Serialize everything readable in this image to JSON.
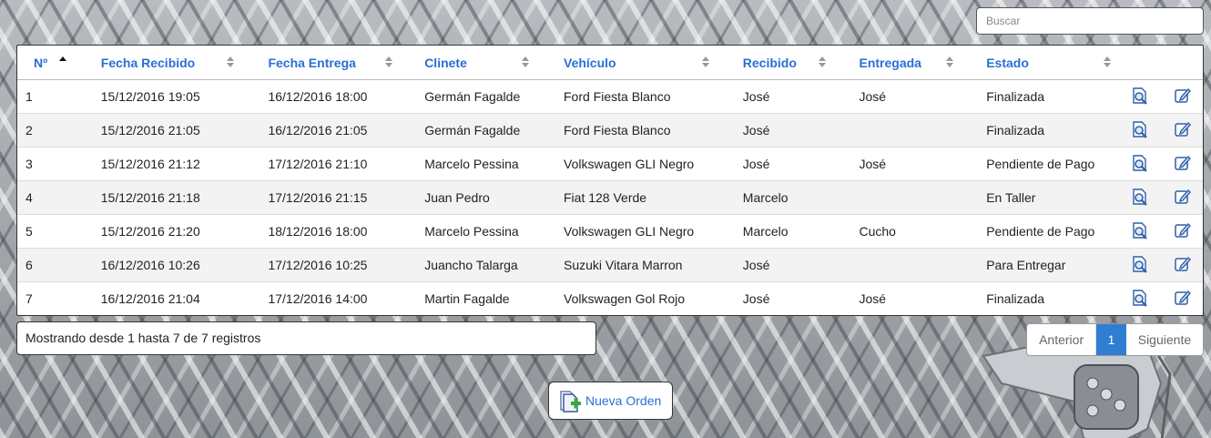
{
  "search": {
    "placeholder": "Buscar"
  },
  "table": {
    "columns": [
      {
        "label": "Nº",
        "sort": "asc"
      },
      {
        "label": "Fecha Recibido",
        "sort": "none"
      },
      {
        "label": "Fecha Entrega",
        "sort": "none"
      },
      {
        "label": "Clinete",
        "sort": "none"
      },
      {
        "label": "Vehículo",
        "sort": "none"
      },
      {
        "label": "Recibido",
        "sort": "none"
      },
      {
        "label": "Entregada",
        "sort": "none"
      },
      {
        "label": "Estado",
        "sort": "none"
      }
    ],
    "rows": [
      [
        "1",
        "15/12/2016 19:05",
        "16/12/2016 18:00",
        "Germán Fagalde",
        "Ford Fiesta Blanco",
        "José",
        "José",
        "Finalizada"
      ],
      [
        "2",
        "15/12/2016 21:05",
        "16/12/2016 21:05",
        "Germán Fagalde",
        "Ford Fiesta Blanco",
        "José",
        "",
        "Finalizada"
      ],
      [
        "3",
        "15/12/2016 21:12",
        "17/12/2016 21:10",
        "Marcelo Pessina",
        "Volkswagen GLI Negro",
        "José",
        "José",
        "Pendiente de Pago"
      ],
      [
        "4",
        "15/12/2016 21:18",
        "17/12/2016 21:15",
        "Juan Pedro",
        "Fiat 128 Verde",
        "Marcelo",
        "",
        "En Taller"
      ],
      [
        "5",
        "15/12/2016 21:20",
        "18/12/2016 18:00",
        "Marcelo Pessina",
        "Volkswagen GLI Negro",
        "Marcelo",
        "Cucho",
        "Pendiente de Pago"
      ],
      [
        "6",
        "16/12/2016 10:26",
        "17/12/2016 10:25",
        "Juancho Talarga",
        "Suzuki Vitara Marron",
        "José",
        "",
        "Para Entregar"
      ],
      [
        "7",
        "16/12/2016 21:04",
        "17/12/2016 14:00",
        "Martin Fagalde",
        "Volkswagen Gol Rojo",
        "José",
        "José",
        "Finalizada"
      ]
    ],
    "row_actions": [
      "view-icon",
      "edit-icon"
    ]
  },
  "info": {
    "text": "Mostrando desde 1 hasta 7 de 7 registros"
  },
  "pagination": {
    "prev": "Anterior",
    "current": "1",
    "next": "Siguiente"
  },
  "new_order": {
    "label": "Nueva Orden",
    "icon": "add-document-icon"
  },
  "colors": {
    "accent": "#2a6fd6",
    "page_active": "#2f7ed1"
  }
}
